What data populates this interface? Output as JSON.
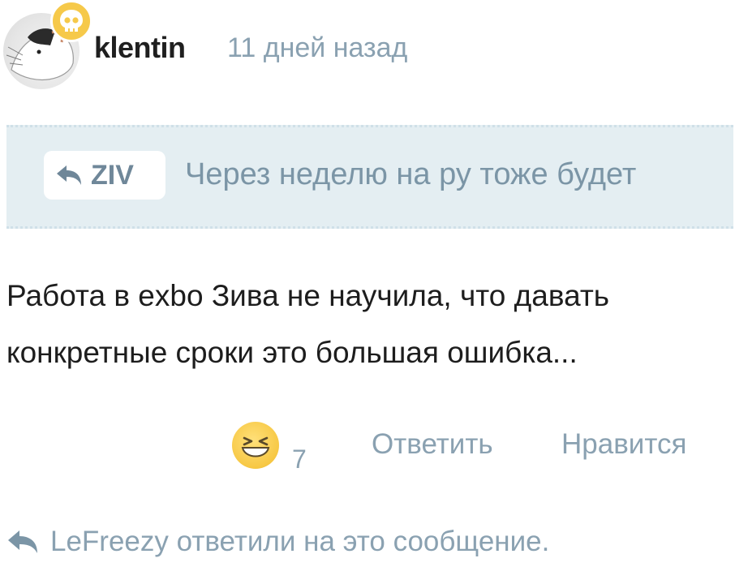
{
  "comment": {
    "author": "klentin",
    "time_ago": "11 дней назад",
    "quote": {
      "author": "ZIV",
      "text": "Через неделю на ру тоже будет"
    },
    "body_lines": [
      "Работа в exbo Зива не научила, что давать",
      "конкретные сроки это большая ошибка..."
    ],
    "reaction_count": "7",
    "reply_label": "Ответить",
    "like_label": "Нравится",
    "replies_notice": "LeFreezy ответили на это сообщение."
  },
  "icons": {
    "badge": "skull-icon",
    "reply": "reply-arrow-icon",
    "reaction": "laughing-emoji-icon"
  },
  "colors": {
    "muted_text": "#8aa1b1",
    "quote_background": "#e4eef2",
    "badge": "#f6c94a",
    "emoji": "#f7c844"
  }
}
